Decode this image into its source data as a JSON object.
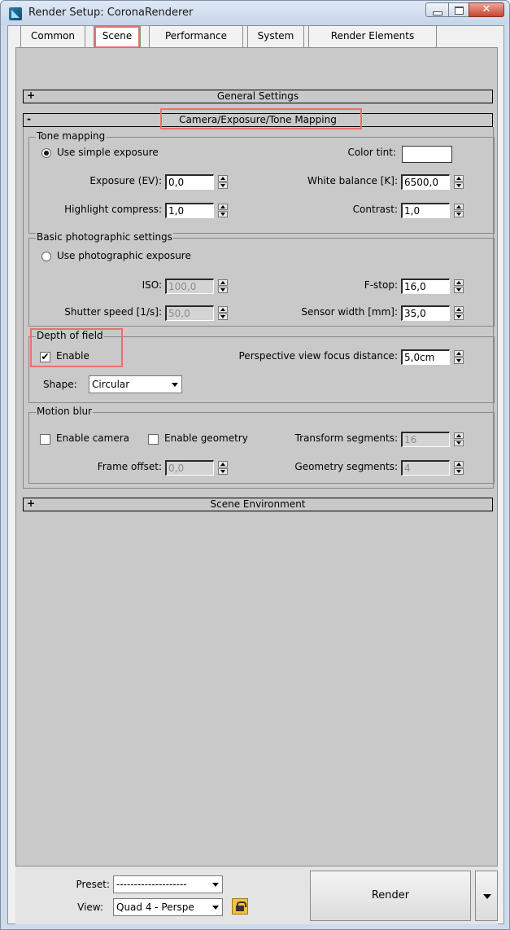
{
  "window": {
    "title": "Render Setup: CoronaRenderer"
  },
  "tabs": [
    "Common",
    "Scene",
    "Performance",
    "System",
    "Render Elements"
  ],
  "active_tab": "Scene",
  "rollouts": {
    "general": {
      "sign": "+",
      "title": "General Settings"
    },
    "camera": {
      "sign": "-",
      "title": "Camera/Exposure/Tone Mapping"
    },
    "environment": {
      "sign": "+",
      "title": "Scene Environment"
    }
  },
  "tone_mapping": {
    "title": "Tone mapping",
    "use_simple_exposure": "Use simple exposure",
    "exposure_label": "Exposure (EV):",
    "exposure_value": "0,0",
    "highlight_label": "Highlight compress:",
    "highlight_value": "1,0",
    "color_tint_label": "Color tint:",
    "white_balance_label": "White balance [K]:",
    "white_balance_value": "6500,0",
    "contrast_label": "Contrast:",
    "contrast_value": "1,0"
  },
  "photographic": {
    "title": "Basic photographic settings",
    "use_photographic": "Use photographic exposure",
    "iso_label": "ISO:",
    "iso_value": "100,0",
    "shutter_label": "Shutter speed [1/s]:",
    "shutter_value": "50,0",
    "fstop_label": "F-stop:",
    "fstop_value": "16,0",
    "sensor_label": "Sensor width [mm]:",
    "sensor_value": "35,0"
  },
  "dof": {
    "title": "Depth of field",
    "enable_label": "Enable",
    "focus_label": "Perspective view focus distance:",
    "focus_value": "5,0cm",
    "shape_label": "Shape:",
    "shape_value": "Circular"
  },
  "motion_blur": {
    "title": "Motion blur",
    "enable_camera": "Enable camera",
    "enable_geometry": "Enable geometry",
    "transform_label": "Transform segments:",
    "transform_value": "16",
    "frame_offset_label": "Frame offset:",
    "frame_offset_value": "0,0",
    "geometry_label": "Geometry segments:",
    "geometry_value": "4"
  },
  "bottom": {
    "preset_label": "Preset:",
    "preset_value": "--------------------",
    "view_label": "View:",
    "view_value": "Quad 4 - Perspe",
    "render_label": "Render"
  },
  "colors": {
    "highlight": "#e8726a",
    "panel": "#c9c9c9"
  }
}
